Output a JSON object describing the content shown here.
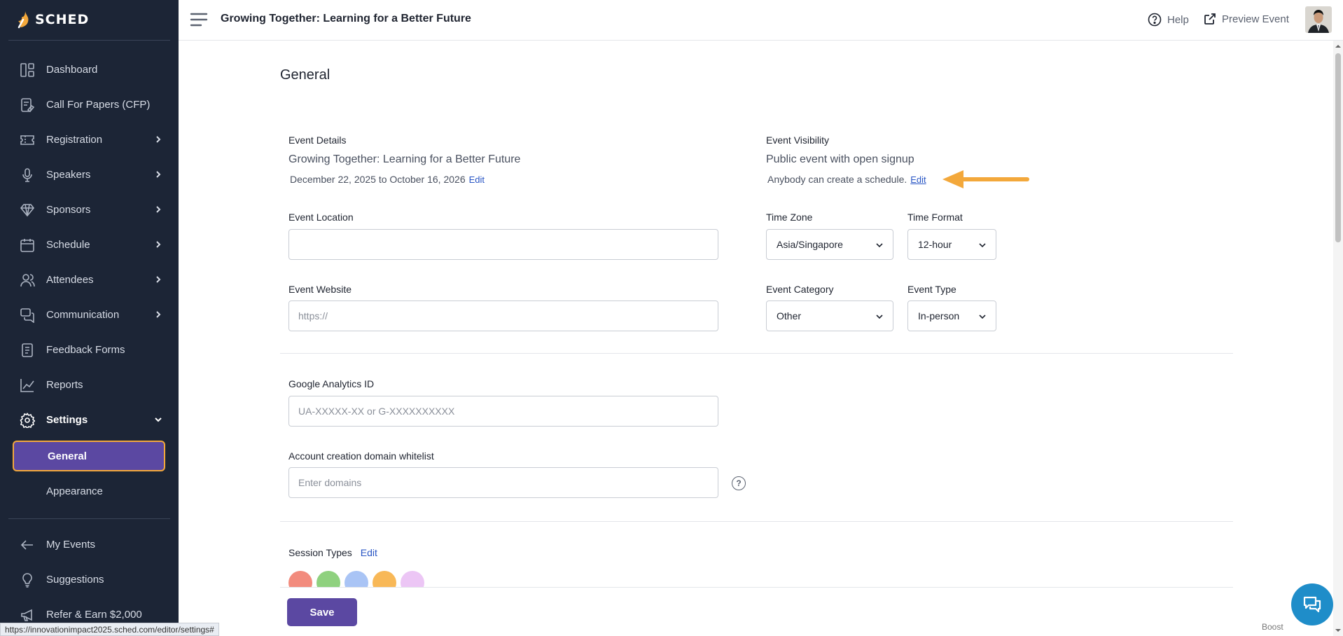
{
  "brand": {
    "name": "SCHED"
  },
  "sidebar": {
    "items": [
      {
        "label": "Dashboard",
        "icon": "dashboard-icon",
        "chevron": false
      },
      {
        "label": "Call For Papers (CFP)",
        "icon": "cfp-icon",
        "chevron": false
      },
      {
        "label": "Registration",
        "icon": "ticket-icon",
        "chevron": true
      },
      {
        "label": "Speakers",
        "icon": "microphone-icon",
        "chevron": true
      },
      {
        "label": "Sponsors",
        "icon": "diamond-icon",
        "chevron": true
      },
      {
        "label": "Schedule",
        "icon": "calendar-icon",
        "chevron": true
      },
      {
        "label": "Attendees",
        "icon": "users-icon",
        "chevron": true
      },
      {
        "label": "Communication",
        "icon": "chat-icon",
        "chevron": true
      },
      {
        "label": "Feedback Forms",
        "icon": "form-icon",
        "chevron": false
      },
      {
        "label": "Reports",
        "icon": "chart-icon",
        "chevron": false
      },
      {
        "label": "Settings",
        "icon": "gear-icon",
        "chevron": true,
        "expanded": true
      }
    ],
    "settings_sub": [
      {
        "label": "General",
        "active": true
      },
      {
        "label": "Appearance",
        "active": false
      }
    ],
    "bottom_items": [
      {
        "label": "My Events",
        "icon": "arrow-left-icon"
      },
      {
        "label": "Suggestions",
        "icon": "lightbulb-icon"
      },
      {
        "label": "Refer & Earn $2,000",
        "icon": "megaphone-icon"
      }
    ]
  },
  "topbar": {
    "event_title": "Growing Together: Learning for a Better Future",
    "help_label": "Help",
    "preview_label": "Preview Event"
  },
  "page": {
    "title": "General",
    "event_details": {
      "label": "Event Details",
      "name": "Growing Together: Learning for a Better Future",
      "dates": "December 22, 2025 to October 16, 2026",
      "edit_label": "Edit"
    },
    "event_visibility": {
      "label": "Event Visibility",
      "value": "Public event with open signup",
      "description": "Anybody can create a schedule.",
      "edit_label": "Edit"
    },
    "event_location": {
      "label": "Event Location",
      "value": "",
      "placeholder": ""
    },
    "event_website": {
      "label": "Event Website",
      "value": "",
      "placeholder": "https://"
    },
    "time_zone": {
      "label": "Time Zone",
      "value": "Asia/Singapore"
    },
    "time_format": {
      "label": "Time Format",
      "value": "12-hour"
    },
    "event_category": {
      "label": "Event Category",
      "value": "Other"
    },
    "event_type": {
      "label": "Event Type",
      "value": "In-person"
    },
    "google_analytics": {
      "label": "Google Analytics ID",
      "value": "",
      "placeholder": "UA-XXXXX-XX or G-XXXXXXXXXX"
    },
    "domain_whitelist": {
      "label": "Account creation domain whitelist",
      "value": "",
      "placeholder": "Enter domains",
      "help": "?"
    },
    "session_types": {
      "label": "Session Types",
      "edit_label": "Edit",
      "colors": [
        "#f28b7d",
        "#8fd17f",
        "#a9c4f5",
        "#f8b857",
        "#ecc6f5"
      ]
    },
    "save_label": "Save"
  },
  "footer": {
    "boost_label": "Boost",
    "status_url": "https://innovationimpact2025.sched.com/editor/settings#"
  },
  "colors": {
    "sidebar_bg": "#1c2536",
    "accent": "#5b48a2",
    "highlight_border": "#f3a83b",
    "link": "#2855c4",
    "annotation_arrow": "#f3a83b",
    "chat_button": "#1f8dc9"
  }
}
